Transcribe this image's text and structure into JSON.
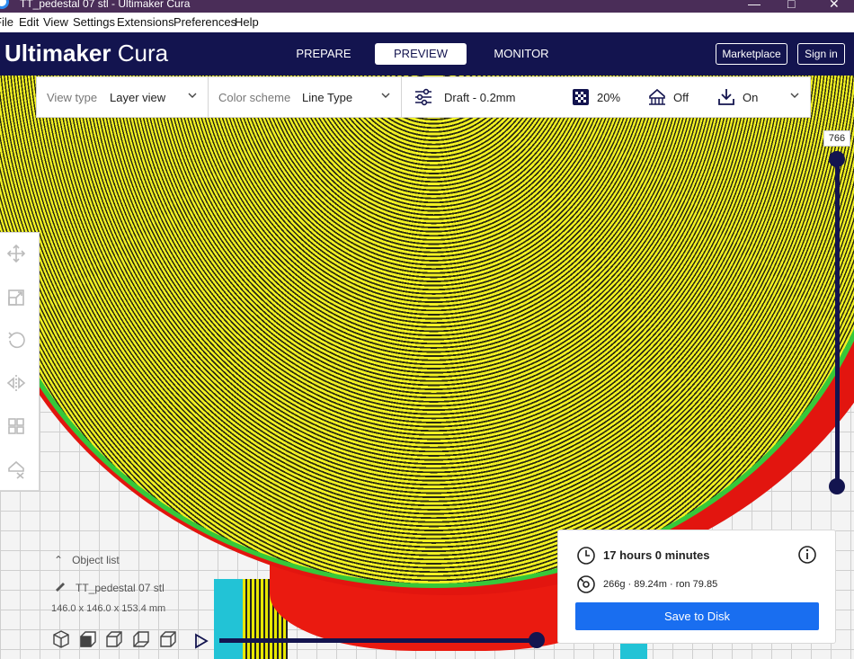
{
  "window": {
    "title": "TT_pedestal 07 stl - Ultimaker Cura"
  },
  "menu": [
    "File",
    "Edit",
    "View",
    "Settings",
    "Extensions",
    "Preferences",
    "Help"
  ],
  "header": {
    "logo_bold": "Ultimaker",
    "logo_light": "Cura",
    "tabs": [
      "PREPARE",
      "PREVIEW",
      "MONITOR"
    ],
    "active_tab": "PREVIEW",
    "marketplace_label": "Marketplace",
    "signin_label": "Sign in"
  },
  "toolbar": {
    "view_type_label": "View type",
    "view_type_value": "Layer view",
    "color_scheme_label": "Color scheme",
    "color_scheme_value": "Line Type",
    "profile": "Draft - 0.2mm",
    "infill": "20%",
    "support": "Off",
    "adhesion": "On"
  },
  "layer_slider": {
    "current_layer": "766"
  },
  "object_list": {
    "header": "Object list",
    "object_name": "TT_pedestal 07 stl",
    "dimensions": "146.0 x 146.0 x 153.4 mm"
  },
  "print_info": {
    "time": "17 hours 0 minutes",
    "material": "266g · 89.24m · ron 79.85",
    "save_label": "Save to Disk"
  },
  "colors": {
    "header_bg": "#13144f",
    "accent_blue": "#196ef0",
    "model_yellow": "#ecec1c",
    "model_red": "#e2150f",
    "model_green": "#36c83a",
    "support_cyan": "#22c3d6"
  },
  "icons": {
    "tools": [
      "move-icon",
      "scale-icon",
      "rotate-icon",
      "mirror-icon",
      "per-model-settings-icon",
      "support-blocker-icon"
    ],
    "view_buttons": [
      "3d-view-icon",
      "front-view-icon",
      "top-view-icon",
      "left-view-icon",
      "right-view-icon"
    ]
  }
}
